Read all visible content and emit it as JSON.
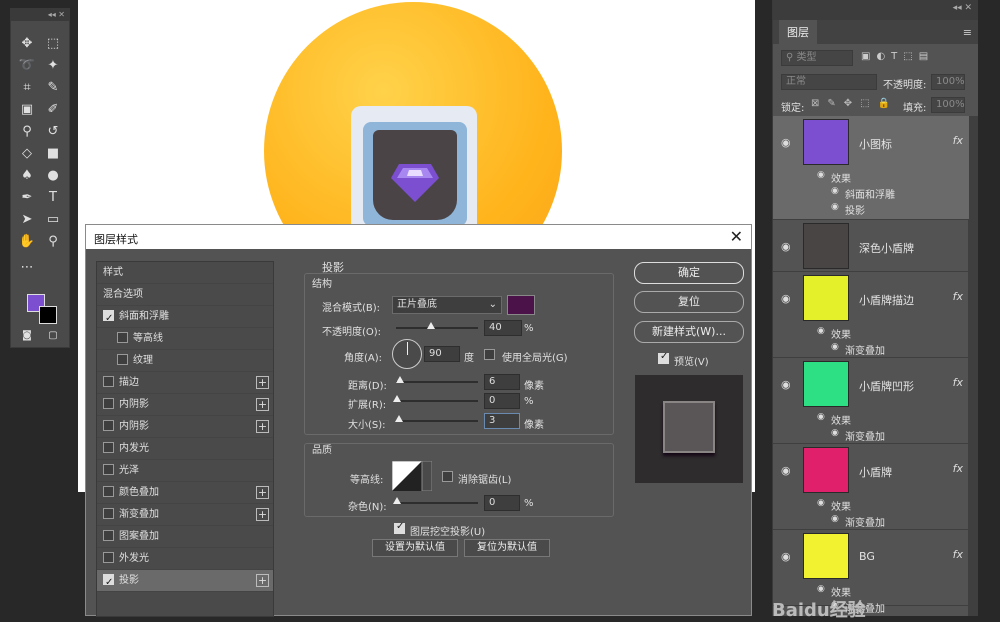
{
  "toolbox": {
    "header": "◂◂  ✕",
    "tools": [
      "move",
      "marquee",
      "lasso",
      "magic-wand",
      "crop",
      "eyedropper",
      "frame",
      "brush",
      "stamp",
      "history-brush",
      "eraser",
      "gradient",
      "blur",
      "dodge",
      "pen",
      "type",
      "path-select",
      "shape",
      "hand",
      "zoom",
      "more"
    ],
    "foreground_color": "#7b4fd0",
    "background_color": "#000000"
  },
  "layers_panel": {
    "topbar": "◂◂  ✕",
    "tab": "图层",
    "filter_placeholder": "类型",
    "blend_mode": "正常",
    "opacity_label": "不透明度:",
    "opacity_value": "100%",
    "lock_label": "锁定:",
    "fill_label": "填充:",
    "fill_value": "100%",
    "layers": [
      {
        "name": "小图标",
        "color": "#7b4fd0",
        "fx": "fx",
        "effects_label": "效果",
        "effects": [
          "斜面和浮雕",
          "投影"
        ]
      },
      {
        "name": "深色小盾牌",
        "color": "#4a4545",
        "fx": "",
        "effects_label": "",
        "effects": []
      },
      {
        "name": "小盾牌描边",
        "color": "#e4f02a",
        "fx": "fx",
        "effects_label": "效果",
        "effects": [
          "渐变叠加"
        ]
      },
      {
        "name": "小盾牌凹形",
        "color": "#2ee084",
        "fx": "fx",
        "effects_label": "效果",
        "effects": [
          "渐变叠加"
        ]
      },
      {
        "name": "小盾牌",
        "color": "#e0206a",
        "fx": "fx",
        "effects_label": "效果",
        "effects": [
          "渐变叠加"
        ]
      },
      {
        "name": "BG",
        "color": "#f2f230",
        "fx": "fx",
        "effects_label": "效果",
        "effects": [
          "渐变叠加"
        ]
      }
    ]
  },
  "dialog": {
    "title": "图层样式",
    "close": "✕",
    "style_list": [
      {
        "label": "样式",
        "checkbox": false,
        "checked": false,
        "plus": false,
        "selected": false
      },
      {
        "label": "混合选项",
        "checkbox": false,
        "checked": false,
        "plus": false,
        "selected": false
      },
      {
        "label": "斜面和浮雕",
        "checkbox": true,
        "checked": true,
        "plus": false,
        "selected": false
      },
      {
        "label": "等高线",
        "checkbox": true,
        "checked": false,
        "plus": false,
        "selected": false,
        "indent": true
      },
      {
        "label": "纹理",
        "checkbox": true,
        "checked": false,
        "plus": false,
        "selected": false,
        "indent": true
      },
      {
        "label": "描边",
        "checkbox": true,
        "checked": false,
        "plus": true,
        "selected": false
      },
      {
        "label": "内阴影",
        "checkbox": true,
        "checked": false,
        "plus": true,
        "selected": false
      },
      {
        "label": "内阴影",
        "checkbox": true,
        "checked": false,
        "plus": true,
        "selected": false
      },
      {
        "label": "内发光",
        "checkbox": true,
        "checked": false,
        "plus": false,
        "selected": false
      },
      {
        "label": "光泽",
        "checkbox": true,
        "checked": false,
        "plus": false,
        "selected": false
      },
      {
        "label": "颜色叠加",
        "checkbox": true,
        "checked": false,
        "plus": true,
        "selected": false
      },
      {
        "label": "渐变叠加",
        "checkbox": true,
        "checked": false,
        "plus": true,
        "selected": false
      },
      {
        "label": "图案叠加",
        "checkbox": true,
        "checked": false,
        "plus": false,
        "selected": false
      },
      {
        "label": "外发光",
        "checkbox": true,
        "checked": false,
        "plus": false,
        "selected": false
      },
      {
        "label": "投影",
        "checkbox": true,
        "checked": true,
        "plus": true,
        "selected": true
      }
    ],
    "section_title": "投影",
    "structure": {
      "title": "结构",
      "blend_mode_label": "混合模式(B):",
      "blend_mode_value": "正片叠底",
      "shadow_color": "#4a1248",
      "opacity_label": "不透明度(O):",
      "opacity_value": "40",
      "opacity_unit": "%",
      "angle_label": "角度(A):",
      "angle_value": "90",
      "angle_unit": "度",
      "global_light_label": "使用全局光(G)",
      "distance_label": "距离(D):",
      "distance_value": "6",
      "distance_unit": "像素",
      "spread_label": "扩展(R):",
      "spread_value": "0",
      "spread_unit": "%",
      "size_label": "大小(S):",
      "size_value": "3",
      "size_unit": "像素"
    },
    "quality": {
      "title": "品质",
      "contour_label": "等高线:",
      "anti_alias_label": "消除锯齿(L)",
      "noise_label": "杂色(N):",
      "noise_value": "0",
      "noise_unit": "%"
    },
    "knockout_label": "图层挖空投影(U)",
    "set_default": "设置为默认值",
    "reset_default": "复位为默认值",
    "ok": "确定",
    "reset": "复位",
    "new_style": "新建样式(W)...",
    "preview_label": "预览(V)"
  },
  "watermark": "Baidu经验"
}
